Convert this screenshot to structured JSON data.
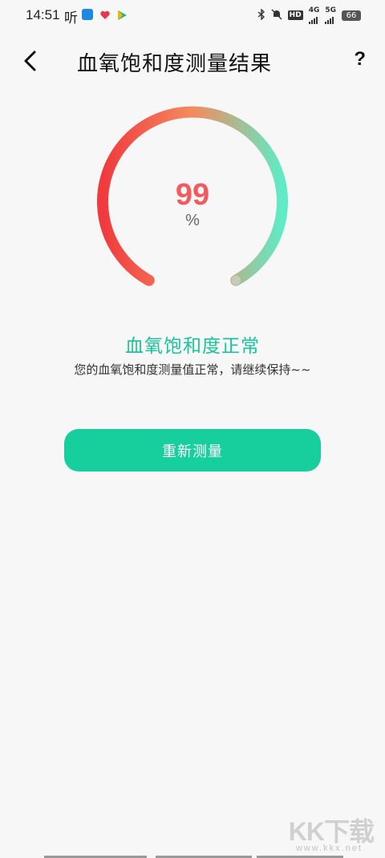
{
  "status_bar": {
    "time": "14:51",
    "ting": "听",
    "hd_label": "HD",
    "network_4g": "4G",
    "network_5g": "5G",
    "battery": "66"
  },
  "header": {
    "title": "血氧饱和度测量结果",
    "help": "?"
  },
  "gauge": {
    "value": "99",
    "unit": "%",
    "gradient_start": "#f03a3e",
    "gradient_mid": "#f58a5e",
    "gradient_end": "#5eecc6"
  },
  "result": {
    "title": "血氧饱和度正常",
    "description": "您的血氧饱和度测量值正常，请继续保持~~"
  },
  "actions": {
    "remeasure": "重新测量"
  },
  "watermark": {
    "text": "KK下载",
    "sub": "www.kkx.net"
  }
}
